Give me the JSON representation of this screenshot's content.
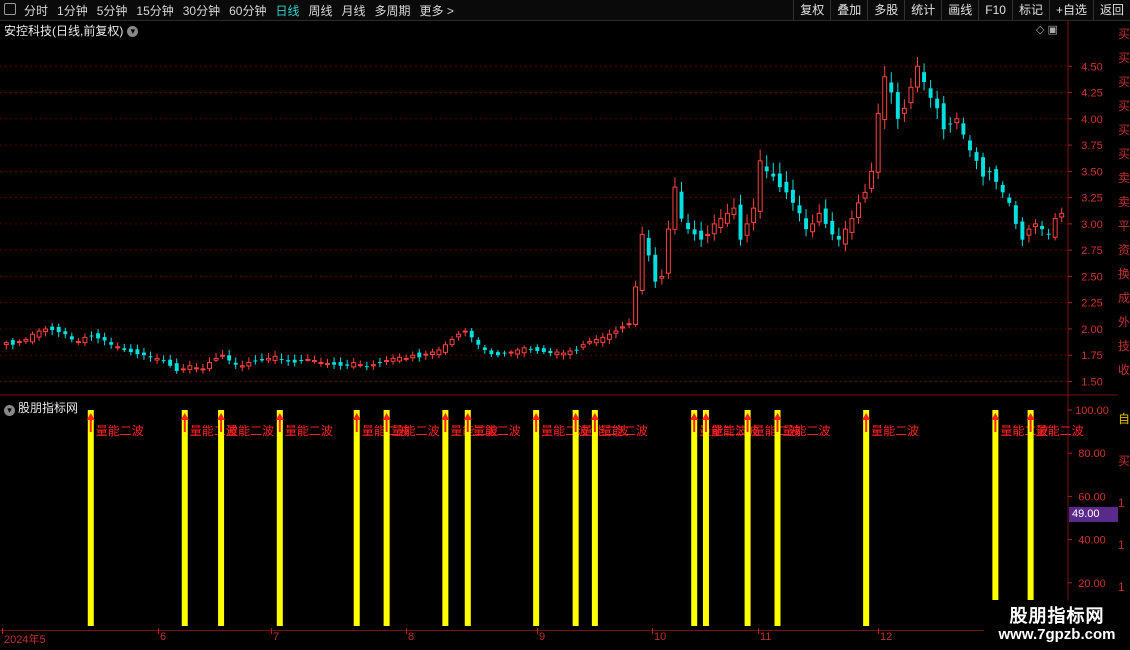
{
  "toolbar": {
    "periods": [
      "分时",
      "1分钟",
      "5分钟",
      "15分钟",
      "30分钟",
      "60分钟",
      "日线",
      "周线",
      "月线",
      "多周期",
      "更多"
    ],
    "active_period": "日线",
    "more_chevron": ">",
    "tools": [
      "复权",
      "叠加",
      "多股",
      "统计",
      "画线",
      "F10",
      "标记",
      "+自选",
      "返回"
    ]
  },
  "main": {
    "title": "安控科技(日线,前复权)",
    "icons": [
      "diamond-icon",
      "window-icon"
    ],
    "y_ticks": [
      "4.50",
      "4.25",
      "4.00",
      "3.75",
      "3.50",
      "3.25",
      "3.00",
      "2.75",
      "2.50",
      "2.25",
      "2.00",
      "1.75",
      "1.50"
    ]
  },
  "indicator": {
    "title": "股朋指标网",
    "y_ticks": [
      "100.00",
      "80.00",
      "60.00",
      "40.00",
      "20.00"
    ],
    "current_value": "49.00",
    "signal_label": "量能二波"
  },
  "xaxis": {
    "labels": [
      "2024年5",
      "6",
      "7",
      "8",
      "9",
      "10",
      "11",
      "12"
    ]
  },
  "right_strip": {
    "chars": [
      "买",
      "买",
      "买",
      "买",
      "买",
      "买",
      "卖",
      "卖",
      "平",
      "资",
      "换",
      "成",
      "外",
      "技",
      "收"
    ],
    "chars2": [
      "自",
      "买",
      "1",
      "1",
      "1",
      "1"
    ]
  },
  "watermark": {
    "name": "股朋指标网",
    "url": "www.7gpzb.com"
  },
  "colors": {
    "up": "#ff4040",
    "down": "#00e0e0",
    "signal_bar": "#ffff00",
    "signal_text": "#ff2020",
    "grid": "#5a0000"
  },
  "chart_data": [
    {
      "type": "candlestick",
      "title": "安控科技(日线,前复权)",
      "ylim": [
        1.4,
        4.75
      ],
      "x_labels": [
        "2024年5",
        "6",
        "7",
        "8",
        "9",
        "10",
        "11",
        "12"
      ],
      "note_series": "approximate daily closes read from the chart, May–Dec 2024",
      "closes": [
        1.87,
        1.85,
        1.88,
        1.9,
        1.95,
        1.98,
        2.0,
        1.99,
        1.97,
        1.95,
        1.9,
        1.88,
        1.92,
        1.93,
        1.91,
        1.89,
        1.85,
        1.83,
        1.8,
        1.78,
        1.76,
        1.75,
        1.73,
        1.72,
        1.7,
        1.65,
        1.6,
        1.62,
        1.65,
        1.63,
        1.62,
        1.68,
        1.72,
        1.75,
        1.7,
        1.66,
        1.65,
        1.68,
        1.69,
        1.7,
        1.72,
        1.74,
        1.71,
        1.69,
        1.68,
        1.7,
        1.71,
        1.7,
        1.68,
        1.67,
        1.66,
        1.65,
        1.65,
        1.68,
        1.66,
        1.64,
        1.66,
        1.68,
        1.7,
        1.72,
        1.73,
        1.72,
        1.75,
        1.73,
        1.76,
        1.78,
        1.8,
        1.85,
        1.9,
        1.95,
        1.98,
        1.92,
        1.85,
        1.8,
        1.76,
        1.75,
        1.77,
        1.78,
        1.8,
        1.82,
        1.81,
        1.79,
        1.78,
        1.77,
        1.78,
        1.77,
        1.79,
        1.8,
        1.85,
        1.88,
        1.9,
        1.92,
        1.95,
        1.98,
        2.02,
        2.05,
        2.4,
        2.9,
        2.7,
        2.45,
        2.5,
        2.95,
        3.35,
        3.05,
        2.95,
        2.9,
        2.85,
        2.9,
        3.0,
        3.05,
        3.1,
        3.15,
        2.85,
        3.0,
        3.15,
        3.6,
        3.5,
        3.45,
        3.35,
        3.3,
        3.2,
        3.1,
        2.95,
        3.0,
        3.1,
        3.0,
        2.9,
        2.85,
        2.95,
        3.05,
        3.2,
        3.3,
        3.5,
        4.05,
        4.4,
        4.25,
        4.0,
        4.1,
        4.3,
        4.5,
        4.35,
        4.2,
        4.1,
        3.9,
        3.95,
        4.0,
        3.85,
        3.7,
        3.6,
        3.45,
        3.5,
        3.4,
        3.3,
        3.2,
        3.0,
        2.85,
        2.95,
        3.0,
        2.95,
        2.9,
        3.05,
        3.1
      ]
    },
    {
      "type": "bar",
      "title": "股朋指标网",
      "ylim": [
        0,
        100
      ],
      "signal_value": 100,
      "label": "量能二波",
      "signal_count": 22
    }
  ]
}
